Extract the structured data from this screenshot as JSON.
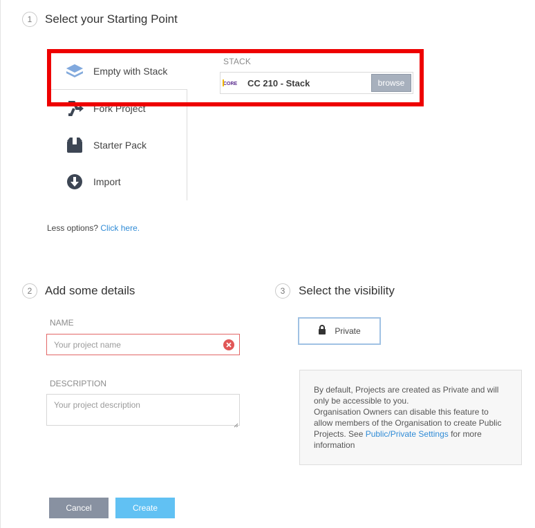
{
  "step1": {
    "number": "1",
    "title": "Select your Starting Point"
  },
  "options": [
    {
      "label": "Empty with Stack",
      "icon": "layers-icon"
    },
    {
      "label": "Fork Project",
      "icon": "fork-icon"
    },
    {
      "label": "Starter Pack",
      "icon": "box-icon"
    },
    {
      "label": "Import",
      "icon": "cloud-download-icon"
    }
  ],
  "stack": {
    "label": "STACK",
    "logo_text": "CORE",
    "name": "CC 210 - Stack",
    "browse_label": "browse"
  },
  "less_options": {
    "text": "Less options? ",
    "link": "Click here."
  },
  "step2": {
    "number": "2",
    "title": "Add some details"
  },
  "name_field": {
    "label": "NAME",
    "placeholder": "Your project name",
    "value": ""
  },
  "description_field": {
    "label": "DESCRIPTION",
    "placeholder": "Your project description",
    "value": ""
  },
  "step3": {
    "number": "3",
    "title": "Select the visibility"
  },
  "visibility": {
    "selected_label": "Private",
    "info_lines": [
      "By default, Projects are created as Private and will",
      "only be accessible to you.",
      "Organisation Owners can disable this feature to",
      "allow members of the Organisation to create Public"
    ],
    "info_pre_link": "Projects. See ",
    "info_link": "Public/Private Settings",
    "info_post_link": " for more",
    "info_last": "information"
  },
  "actions": {
    "cancel_label": "Cancel",
    "create_label": "Create"
  },
  "colors": {
    "highlight": "#ee0000",
    "accent": "#61c1f3",
    "link": "#2f8bd6",
    "error": "#e15757"
  }
}
